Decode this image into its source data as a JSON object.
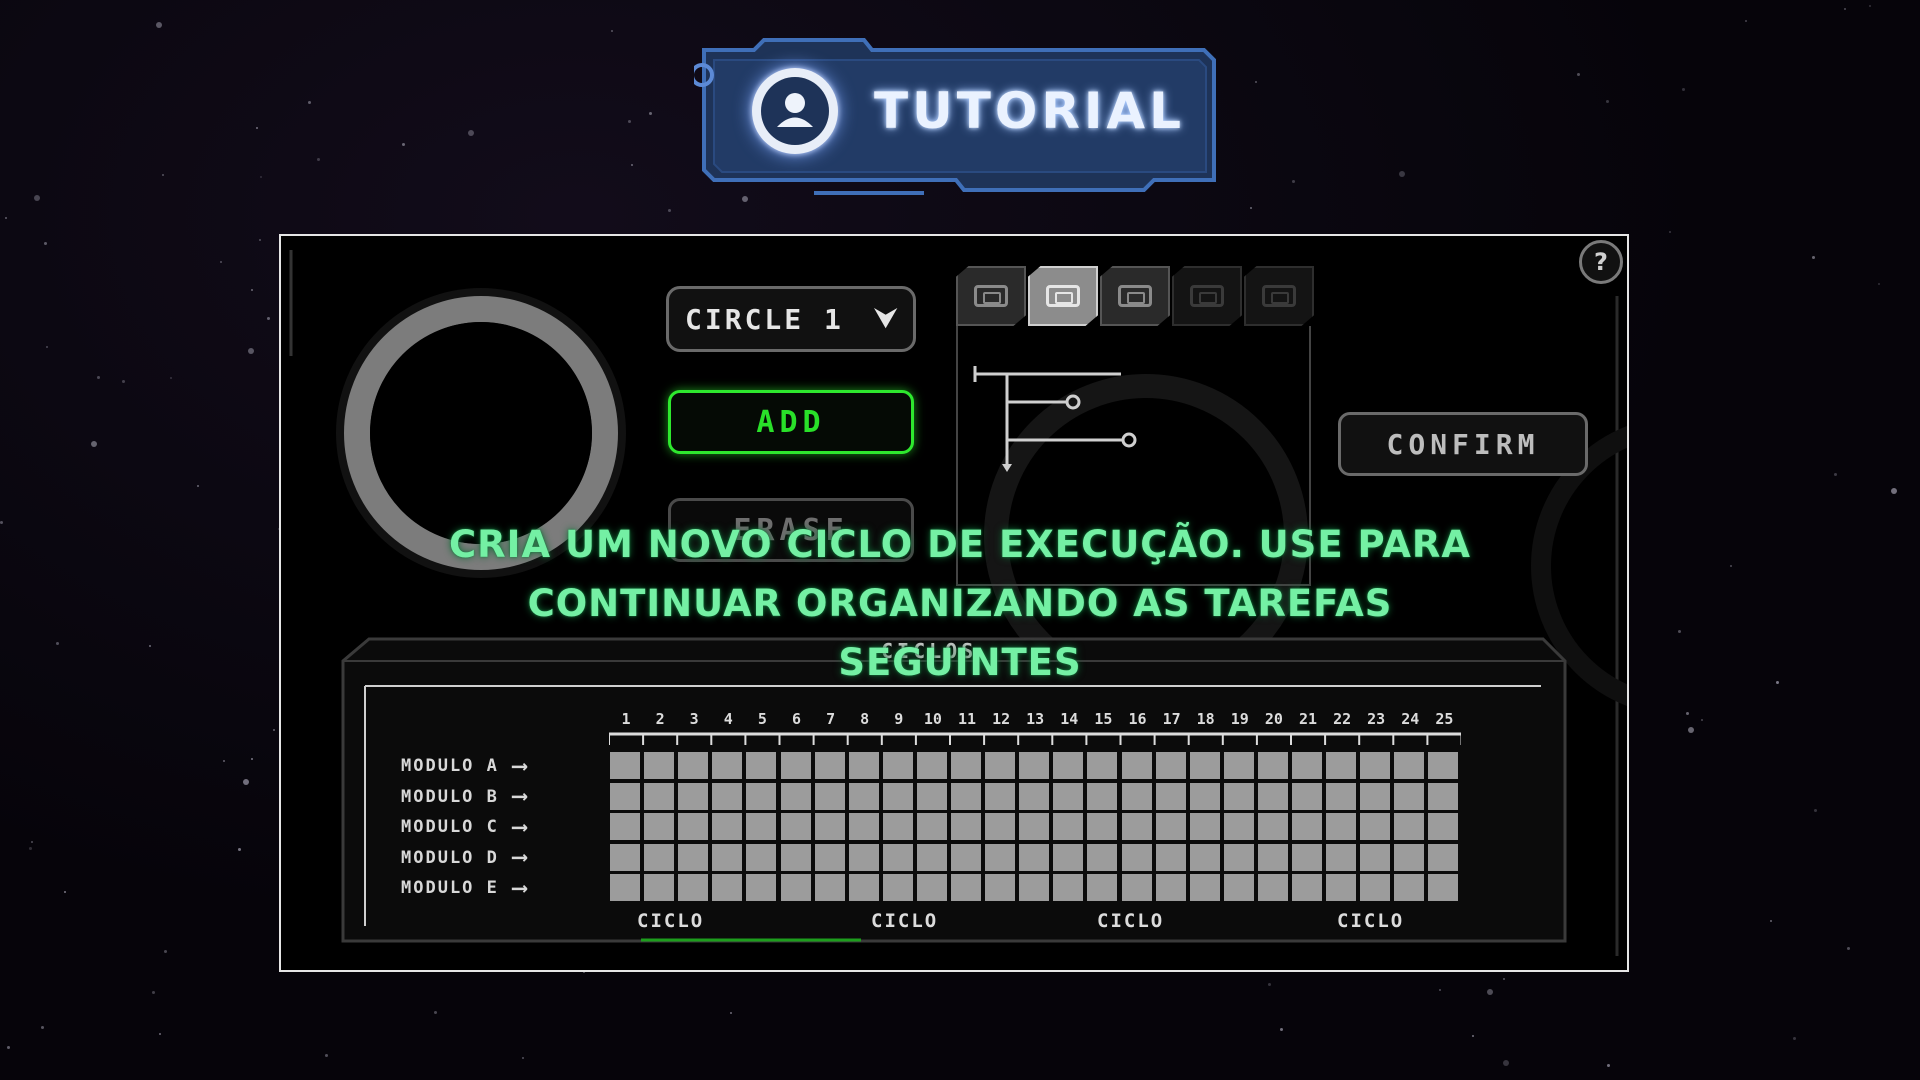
{
  "tutorial_banner": {
    "title": "TUTORIAL",
    "icon": "user-avatar-icon"
  },
  "help": {
    "label": "?"
  },
  "circle_selector": {
    "selected": "CIRCLE 1",
    "icon": "chevron-down-icon"
  },
  "actions": {
    "add_label": "ADD",
    "erase_label": "ERASE",
    "confirm_label": "CONFIRM"
  },
  "tool_tabs": [
    {
      "icon": "module-block-icon",
      "state": "normal"
    },
    {
      "icon": "module-block-icon",
      "state": "active"
    },
    {
      "icon": "module-block-icon",
      "state": "normal"
    },
    {
      "icon": "module-block-icon",
      "state": "dim"
    },
    {
      "icon": "module-block-icon",
      "state": "dim"
    }
  ],
  "timeline": {
    "title": "CICLOS",
    "columns": [
      "1",
      "2",
      "3",
      "4",
      "5",
      "6",
      "7",
      "8",
      "9",
      "10",
      "11",
      "12",
      "13",
      "14",
      "15",
      "16",
      "17",
      "18",
      "19",
      "20",
      "21",
      "22",
      "23",
      "24",
      "25"
    ],
    "rows": [
      {
        "label": "MODULO A"
      },
      {
        "label": "MODULO B"
      },
      {
        "label": "MODULO C"
      },
      {
        "label": "MODULO D"
      },
      {
        "label": "MODULO E"
      }
    ],
    "cycle_labels": [
      "CICLO",
      "CICLO",
      "CICLO",
      "CICLO"
    ]
  },
  "tutorial_caption": "CRIA UM NOVO CICLO DE EXECUÇÃO. USE PARA CONTINUAR ORGANIZANDO AS TAREFAS SEGUINTES",
  "colors": {
    "accent_green": "#29e029",
    "caption_green": "#74f0a4",
    "banner_blue": "#1e3358",
    "cell_gray": "#9c9c9c"
  }
}
